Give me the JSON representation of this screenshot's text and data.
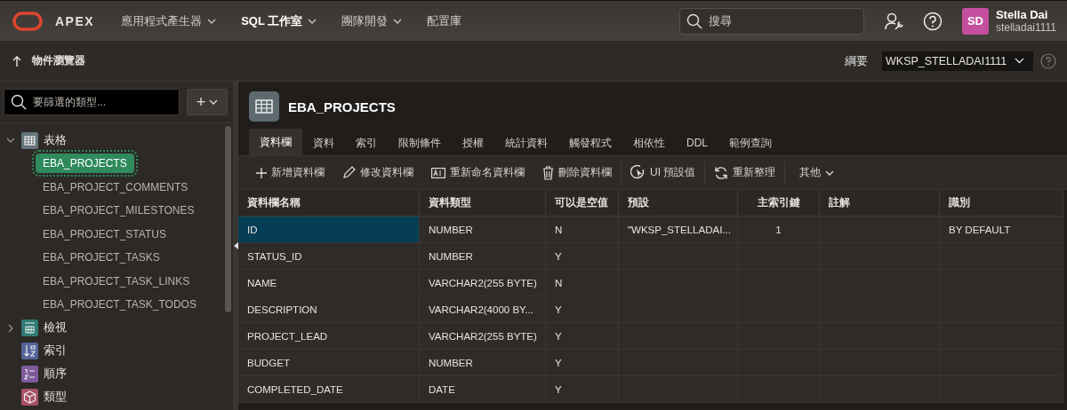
{
  "top_bar": {
    "logo": "APEX",
    "menus": [
      {
        "label": "應用程式產生器",
        "selected": false,
        "dropdown": true
      },
      {
        "label": "SQL 工作室",
        "selected": true,
        "dropdown": true
      },
      {
        "label": "團隊開發",
        "selected": false,
        "dropdown": true
      },
      {
        "label": "配置庫",
        "selected": false,
        "dropdown": false
      }
    ],
    "search": {
      "placeholder": "搜尋"
    },
    "user": {
      "initials": "SD",
      "name": "Stella Dai",
      "username": "stelladai1111"
    }
  },
  "sub_bar": {
    "title": "物件瀏覽器",
    "schema_label": "綱要",
    "schema_value": "WKSP_STELLADAI1111"
  },
  "sidebar": {
    "filter": {
      "placeholder": "要篩選的類型..."
    },
    "add_button": "+",
    "tree": [
      {
        "label": "表格",
        "kind": "table",
        "color": "#66757c",
        "expanded": true,
        "children": [
          {
            "label": "EBA_PROJECTS",
            "selected": true
          },
          {
            "label": "EBA_PROJECT_COMMENTS",
            "selected": false
          },
          {
            "label": "EBA_PROJECT_MILESTONES",
            "selected": false
          },
          {
            "label": "EBA_PROJECT_STATUS",
            "selected": false
          },
          {
            "label": "EBA_PROJECT_TASKS",
            "selected": false
          },
          {
            "label": "EBA_PROJECT_TASK_LINKS",
            "selected": false
          },
          {
            "label": "EBA_PROJECT_TASK_TODOS",
            "selected": false
          }
        ]
      },
      {
        "label": "檢視",
        "kind": "view",
        "color": "#2f7a72",
        "expanded": false
      },
      {
        "label": "索引",
        "kind": "index",
        "color": "#55659a"
      },
      {
        "label": "順序",
        "kind": "sequence",
        "color": "#7e5a9b"
      },
      {
        "label": "類型",
        "kind": "type",
        "color": "#a8506a"
      }
    ]
  },
  "object": {
    "title": "EBA_PROJECTS",
    "tabs": [
      {
        "label": "資料欄",
        "selected": true
      },
      {
        "label": "資料",
        "selected": false
      },
      {
        "label": "索引",
        "selected": false
      },
      {
        "label": "限制條件",
        "selected": false
      },
      {
        "label": "授權",
        "selected": false
      },
      {
        "label": "統計資料",
        "selected": false
      },
      {
        "label": "觸發程式",
        "selected": false
      },
      {
        "label": "相依性",
        "selected": false
      },
      {
        "label": "DDL",
        "selected": false
      },
      {
        "label": "範例查詢",
        "selected": false
      }
    ],
    "toolbar": [
      {
        "label": "新增資料欄",
        "kind": "add"
      },
      {
        "label": "修改資料欄",
        "kind": "edit"
      },
      {
        "label": "重新命名資料欄",
        "kind": "rename"
      },
      {
        "label": "刪除資料欄",
        "kind": "delete"
      },
      {
        "label": "UI 預設值",
        "kind": "defaults"
      },
      {
        "label": "重新整理",
        "kind": "refresh"
      },
      {
        "label": "其他",
        "kind": "more"
      }
    ],
    "table": {
      "columns": [
        "資料欄名稱",
        "資料類型",
        "可以是空值",
        "預設",
        "主索引鍵",
        "註解",
        "識別"
      ],
      "rows": [
        {
          "selected": true,
          "cells": [
            "ID",
            "NUMBER",
            "N",
            "\"WKSP_STELLADAI...",
            "1",
            "",
            "BY DEFAULT"
          ]
        },
        {
          "selected": false,
          "cells": [
            "STATUS_ID",
            "NUMBER",
            "Y",
            "",
            "",
            "",
            ""
          ]
        },
        {
          "selected": false,
          "cells": [
            "NAME",
            "VARCHAR2(255 BYTE)",
            "N",
            "",
            "",
            "",
            ""
          ]
        },
        {
          "selected": false,
          "cells": [
            "DESCRIPTION",
            "VARCHAR2(4000 BY...",
            "Y",
            "",
            "",
            "",
            ""
          ]
        },
        {
          "selected": false,
          "cells": [
            "PROJECT_LEAD",
            "VARCHAR2(255 BYTE)",
            "Y",
            "",
            "",
            "",
            ""
          ]
        },
        {
          "selected": false,
          "cells": [
            "BUDGET",
            "NUMBER",
            "Y",
            "",
            "",
            "",
            ""
          ]
        },
        {
          "selected": false,
          "cells": [
            "COMPLETED_DATE",
            "DATE",
            "Y",
            "",
            "",
            "",
            ""
          ]
        }
      ]
    }
  }
}
